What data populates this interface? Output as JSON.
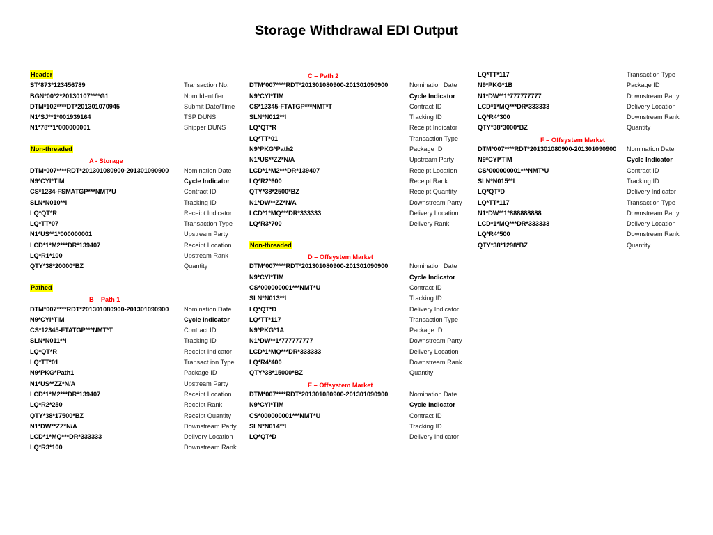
{
  "document": {
    "title": "Storage Withdrawal EDI Output"
  },
  "colors": {
    "highlight": "#ffff00",
    "subheading": "#ff0000",
    "text": "#000000",
    "background": "#ffffff"
  },
  "columns": [
    {
      "id": "column-1",
      "rows": [
        {
          "kind": "group",
          "text": "Header"
        },
        {
          "kind": "entry",
          "segment": "ST*873*123456789",
          "label": "Transaction  No.",
          "bold_label": false
        },
        {
          "kind": "entry",
          "segment": "BGN*00*2*20130107****G1",
          "label": "Nom Identifier",
          "bold_label": false
        },
        {
          "kind": "entry",
          "segment": "DTM*102****DT*201301070945",
          "label": "Submit Date/Time",
          "bold_label": false
        },
        {
          "kind": "entry",
          "segment": "N1*SJ**1*001939164",
          "label": "TSP DUNS",
          "bold_label": false
        },
        {
          "kind": "entry",
          "segment": "N1*78**1*000000001",
          "label": "Shipper DUNS",
          "bold_label": false
        },
        {
          "kind": "spacer"
        },
        {
          "kind": "group",
          "text": "Non-threaded"
        },
        {
          "kind": "sub",
          "text": "A - Storage"
        },
        {
          "kind": "entry",
          "segment": "DTM*007****RDT*201301080900-201301090900",
          "label": "Nomination Date",
          "bold_label": false
        },
        {
          "kind": "entry",
          "segment": "N9*CYI*TIM",
          "label": "Cycle Indicator",
          "bold_label": true
        },
        {
          "kind": "entry",
          "segment": "CS*1234-FSMATGP***NMT*U",
          "label": "Contract ID",
          "bold_label": false
        },
        {
          "kind": "entry",
          "segment": "SLN*N010**I",
          "label": "Tracking ID",
          "bold_label": false
        },
        {
          "kind": "entry",
          "segment": "LQ*QT*R",
          "label": "Receipt Indicator",
          "bold_label": false
        },
        {
          "kind": "entry",
          "segment": "LQ*TT*07",
          "label": "Transaction Type",
          "bold_label": false
        },
        {
          "kind": "entry",
          "segment": "N1*US**1*000000001",
          "label": "Upstream Party",
          "bold_label": false
        },
        {
          "kind": "entry",
          "segment": "LCD*1*M2***DR*139407",
          "label": "Receipt Location",
          "bold_label": false
        },
        {
          "kind": "entry",
          "segment": "LQ*R1*100",
          "label": "Upstream Rank",
          "bold_label": false
        },
        {
          "kind": "entry",
          "segment": "QTY*38*20000*BZ",
          "label": "Quantity",
          "bold_label": false
        },
        {
          "kind": "spacer"
        },
        {
          "kind": "group",
          "text": "Pathed"
        },
        {
          "kind": "sub",
          "text": "B – Path 1"
        },
        {
          "kind": "entry",
          "segment": "DTM*007****RDT*201301080900-201301090900",
          "label": "Nomination Date",
          "bold_label": false
        },
        {
          "kind": "entry",
          "segment": "N9*CYI*TIM",
          "label": "Cycle Indicator",
          "bold_label": true
        },
        {
          "kind": "entry",
          "segment": "CS*12345-FTATGP***NMT*T",
          "label": "Contract ID",
          "bold_label": false
        },
        {
          "kind": "entry",
          "segment": "SLN*N011**I",
          "label": "Tracking ID",
          "bold_label": false
        },
        {
          "kind": "entry",
          "segment": "LQ*QT*R",
          "label": "Receipt Indicator",
          "bold_label": false
        },
        {
          "kind": "entry",
          "segment": "LQ*TT*01",
          "label": "Transact ion Type",
          "bold_label": false
        },
        {
          "kind": "entry",
          "segment": "N9*PKG*Path1",
          "label": "Package ID",
          "bold_label": false
        },
        {
          "kind": "entry",
          "segment": "N1*US**ZZ*N/A",
          "label": "Upstream Party",
          "bold_label": false
        },
        {
          "kind": "entry",
          "segment": "LCD*1*M2***DR*139407",
          "label": "Receipt Location",
          "bold_label": false
        },
        {
          "kind": "entry",
          "segment": "LQ*R2*250",
          "label": "Receipt Rank",
          "bold_label": false
        },
        {
          "kind": "entry",
          "segment": "QTY*38*17500*BZ",
          "label": "Receipt Quantity",
          "bold_label": false
        },
        {
          "kind": "entry",
          "segment": "N1*DW**ZZ*N/A",
          "label": "Downstream Party",
          "bold_label": false
        },
        {
          "kind": "entry",
          "segment": "LCD*1*MQ***DR*333333",
          "label": "Delivery Location",
          "bold_label": false
        },
        {
          "kind": "entry",
          "segment": "LQ*R3*100",
          "label": "Downstream Rank",
          "bold_label": false
        }
      ]
    },
    {
      "id": "column-2",
      "rows": [
        {
          "kind": "sub",
          "text": "C – Path 2"
        },
        {
          "kind": "entry",
          "segment": "DTM*007****RDT*201301080900-201301090900",
          "label": "Nomination Date",
          "bold_label": false
        },
        {
          "kind": "entry",
          "segment": "N9*CYI*TIM",
          "label": "Cycle Indicator",
          "bold_label": true
        },
        {
          "kind": "entry",
          "segment": "CS*12345-FTATGP***NMT*T",
          "label": "Contract ID",
          "bold_label": false
        },
        {
          "kind": "entry",
          "segment": "SLN*N012**I",
          "label": "Tracking ID",
          "bold_label": false
        },
        {
          "kind": "entry",
          "segment": "LQ*QT*R",
          "label": "Receipt Indicator",
          "bold_label": false
        },
        {
          "kind": "entry",
          "segment": "LQ*TT*01",
          "label": "Transaction Type",
          "bold_label": false
        },
        {
          "kind": "entry",
          "segment": "N9*PKG*Path2",
          "label": "Package ID",
          "bold_label": false
        },
        {
          "kind": "entry",
          "segment": "N1*US**ZZ*N/A",
          "label": "Upstream Party",
          "bold_label": false
        },
        {
          "kind": "entry",
          "segment": "LCD*1*M2***DR*139407",
          "label": "Receipt Location",
          "bold_label": false
        },
        {
          "kind": "entry",
          "segment": "LQ*R2*600",
          "label": "Receipt Rank",
          "bold_label": false
        },
        {
          "kind": "entry",
          "segment": "QTY*38*2500*BZ",
          "label": "Receipt Quantity",
          "bold_label": false
        },
        {
          "kind": "entry",
          "segment": "N1*DW**ZZ*N/A",
          "label": "Downstream Party",
          "bold_label": false
        },
        {
          "kind": "entry",
          "segment": "LCD*1*MQ***DR*333333",
          "label": "Delivery Location",
          "bold_label": false
        },
        {
          "kind": "entry",
          "segment": "LQ*R3*700",
          "label": "Delivery Rank",
          "bold_label": false
        },
        {
          "kind": "spacer"
        },
        {
          "kind": "group",
          "text": "Non-threaded"
        },
        {
          "kind": "sub",
          "text": "D – Offsystem Market"
        },
        {
          "kind": "entry",
          "segment": "DTM*007****RDT*201301080900-201301090900",
          "label": "Nomination Date",
          "bold_label": false
        },
        {
          "kind": "entry",
          "segment": "N9*CYI*TIM",
          "label": "Cycle Indicator",
          "bold_label": true
        },
        {
          "kind": "entry",
          "segment": "CS*000000001***NMT*U",
          "label": "Contract ID",
          "bold_label": false
        },
        {
          "kind": "entry",
          "segment": "SLN*N013**I",
          "label": "Tracking ID",
          "bold_label": false
        },
        {
          "kind": "entry",
          "segment": "LQ*QT*D",
          "label": "Delivery Indicator",
          "bold_label": false
        },
        {
          "kind": "entry",
          "segment": "LQ*TT*117",
          "label": "Transaction Type",
          "bold_label": false
        },
        {
          "kind": "entry",
          "segment": "N9*PKG*1A",
          "label": "Package ID",
          "bold_label": false
        },
        {
          "kind": "entry",
          "segment": "N1*DW**1*777777777",
          "label": "Downstream Party",
          "bold_label": false
        },
        {
          "kind": "entry",
          "segment": "LCD*1*MQ***DR*333333",
          "label": "Delivery Location",
          "bold_label": false
        },
        {
          "kind": "entry",
          "segment": "LQ*R4*400",
          "label": "Downstream Rank",
          "bold_label": false
        },
        {
          "kind": "entry",
          "segment": "QTY*38*15000*BZ",
          "label": "Quantity",
          "bold_label": false
        },
        {
          "kind": "sub",
          "text": "E – Offsystem Market"
        },
        {
          "kind": "entry",
          "segment": "DTM*007****RDT*201301080900-201301090900",
          "label": "Nomination Date",
          "bold_label": false
        },
        {
          "kind": "entry",
          "segment": "N9*CYI*TIM",
          "label": "Cycle Indicator",
          "bold_label": true
        },
        {
          "kind": "entry",
          "segment": "CS*000000001***NMT*U",
          "label": "Contract ID",
          "bold_label": false
        },
        {
          "kind": "entry",
          "segment": "SLN*N014**I",
          "label": "Tracking ID",
          "bold_label": false
        },
        {
          "kind": "entry",
          "segment": "LQ*QT*D",
          "label": "Delivery Indicator",
          "bold_label": false
        }
      ]
    },
    {
      "id": "column-3",
      "rows": [
        {
          "kind": "entry",
          "segment": "LQ*TT*117",
          "label": "Transaction Type",
          "bold_label": false
        },
        {
          "kind": "entry",
          "segment": "N9*PKG*1B",
          "label": "Package ID",
          "bold_label": false
        },
        {
          "kind": "entry",
          "segment": "N1*DW**1*777777777",
          "label": "Downstream Party",
          "bold_label": false
        },
        {
          "kind": "entry",
          "segment": "LCD*1*MQ***DR*333333",
          "label": "Delivery Location",
          "bold_label": false
        },
        {
          "kind": "entry",
          "segment": "LQ*R4*300",
          "label": "Downstream Rank",
          "bold_label": false
        },
        {
          "kind": "entry",
          "segment": "QTY*38*3000*BZ",
          "label": "Quantity",
          "bold_label": false
        },
        {
          "kind": "sub",
          "text": "F – Offsystem Market"
        },
        {
          "kind": "entry",
          "segment": "DTM*007****RDT*201301080900-201301090900",
          "label": "Nomination Date",
          "bold_label": false
        },
        {
          "kind": "entry",
          "segment": "N9*CYI*TIM",
          "label": "Cycle Indicator",
          "bold_label": true
        },
        {
          "kind": "entry",
          "segment": "CS*000000001***NMT*U",
          "label": "Contract ID",
          "bold_label": false
        },
        {
          "kind": "entry",
          "segment": "SLN*N015**I",
          "label": "Tracking ID",
          "bold_label": false
        },
        {
          "kind": "entry",
          "segment": "LQ*QT*D",
          "label": "Delivery Indicator",
          "bold_label": false
        },
        {
          "kind": "entry",
          "segment": "LQ*TT*117",
          "label": "Transaction Type",
          "bold_label": false
        },
        {
          "kind": "entry",
          "segment": "N1*DW**1*888888888",
          "label": "Downstream Party",
          "bold_label": false
        },
        {
          "kind": "entry",
          "segment": "LCD*1*MQ***DR*333333",
          "label": "Delivery Location",
          "bold_label": false
        },
        {
          "kind": "entry",
          "segment": "LQ*R4*500",
          "label": "Downstream Rank",
          "bold_label": false
        },
        {
          "kind": "entry",
          "segment": "QTY*38*1298*BZ",
          "label": "Quantity",
          "bold_label": false
        }
      ]
    }
  ]
}
